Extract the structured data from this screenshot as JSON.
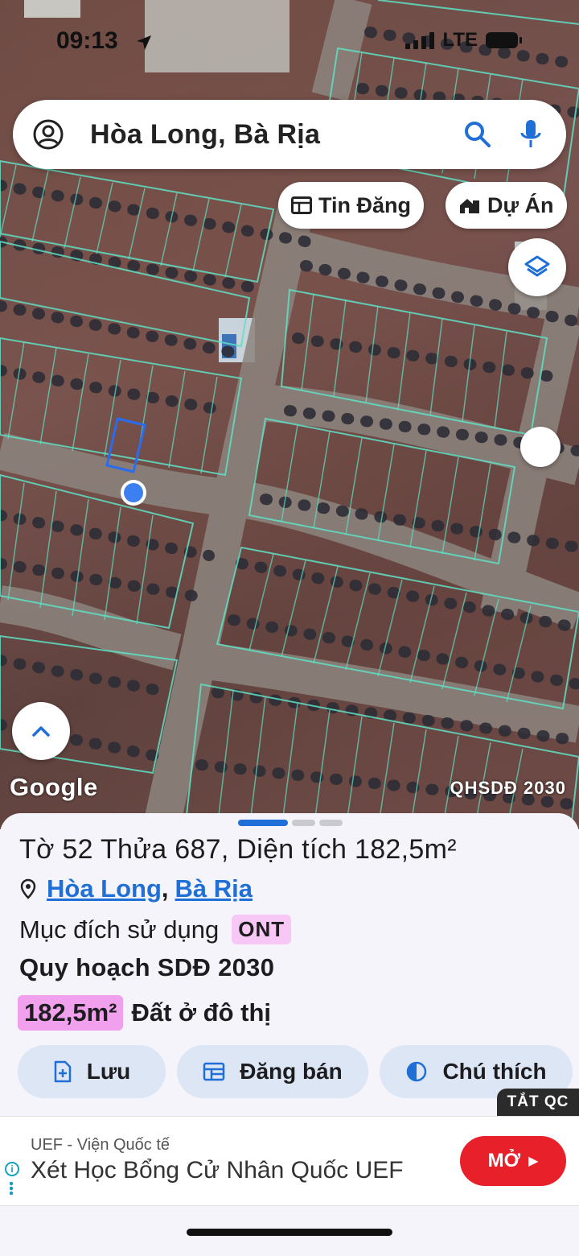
{
  "status_bar": {
    "time": "09:13",
    "network": "LTE"
  },
  "search": {
    "text": "Hòa Long, Bà Rịa",
    "icons": [
      "profile-icon",
      "search-icon",
      "microphone-icon"
    ]
  },
  "chips": {
    "listings": "Tin Đăng",
    "projects": "Dự Án"
  },
  "map": {
    "attribution": "Google",
    "layer_badge": "QHSDĐ 2030"
  },
  "sheet": {
    "parcel_title": "Tờ 52 Thửa 687, Diện tích 182,5m²",
    "ward": "Hòa Long",
    "city": "Bà Rịa",
    "separator": ",",
    "purpose_label": "Mục đích sử dụng",
    "purpose_code": "ONT",
    "plan_title": "Quy hoạch SDĐ 2030",
    "plan_area": "182,5m²",
    "plan_type": "Đất ở đô thị",
    "actions": {
      "save": "Lưu",
      "post_sale": "Đăng bán",
      "legend": "Chú thích"
    },
    "pager_index": 1
  },
  "ad": {
    "close_label": "TẮT QC",
    "source": "UEF - Viện Quốc tế",
    "headline": "Xét Học Bổng Cử Nhân Quốc UEF",
    "cta": "MỞ"
  },
  "colors": {
    "accent": "#1f6fd6",
    "ont_badge": "#f7c8f5",
    "area_badge": "#f1a0ee",
    "cta_red": "#e8202a",
    "parcel_lines": "#5fe0c4"
  }
}
